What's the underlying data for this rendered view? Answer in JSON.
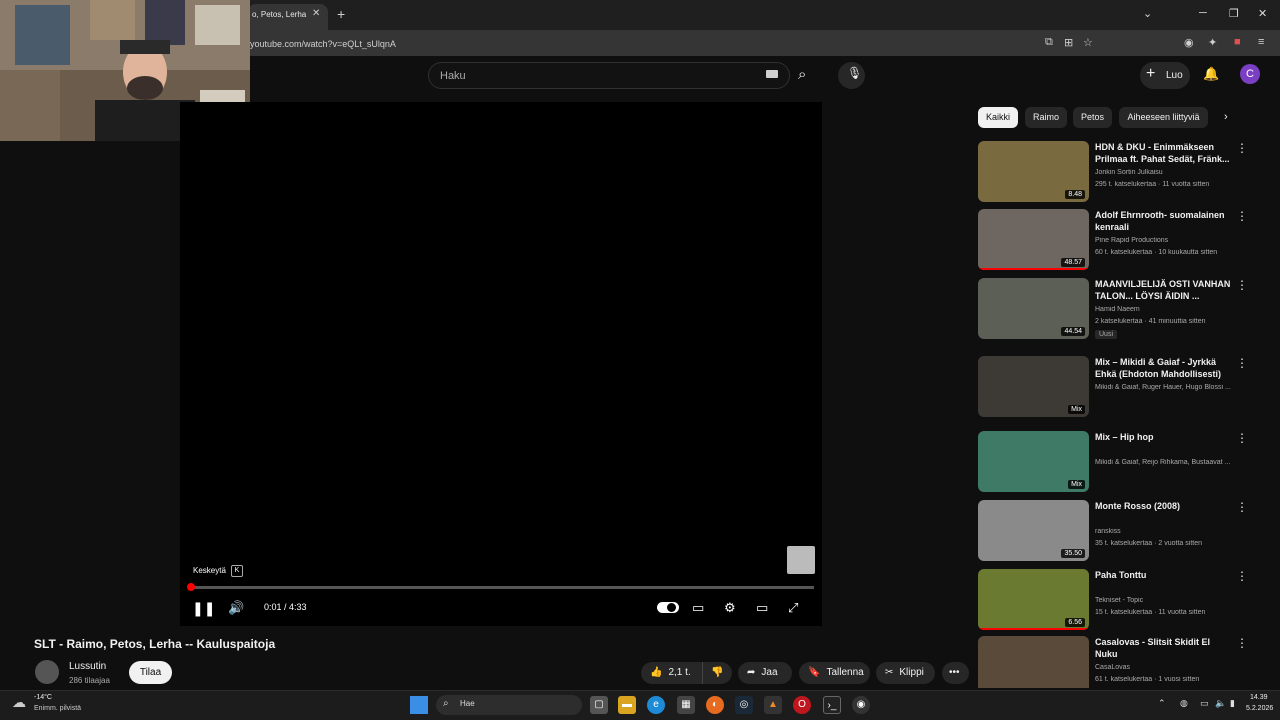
{
  "browser": {
    "tab_title": "o, Petos, Lerha",
    "url": "youtube.com/watch?v=eQLt_sUlqnA"
  },
  "header": {
    "search_placeholder": "Haku",
    "create_label": "Luo",
    "avatar_letter": "C"
  },
  "player": {
    "tooltip": "Keskeytä",
    "tooltip_key": "K",
    "time": "0:01 / 4:33",
    "progress": 0.004
  },
  "video": {
    "title": "SLT - Raimo, Petos, Lerha -- Kauluspaitoja",
    "channel": "Lussutin",
    "subscribers": "286 tilaajaa",
    "subscribe_label": "Tilaa",
    "like_count": "2,1 t.",
    "share_label": "Jaa",
    "save_label": "Tallenna",
    "clip_label": "Klippi"
  },
  "chips": [
    "Kaikki",
    "Raimo",
    "Petos",
    "Aiheeseen liittyviä"
  ],
  "recommendations": [
    {
      "title": "HDN & DKU - Enimmäkseen Prilmaa ft. Pahat Sedät, Fränk...",
      "channel": "Jonkin Sortin Julkaisu",
      "meta": "295 t. katselukertaa · 11 vuotta sitten",
      "duration": "8.48",
      "badge": "",
      "thumb_color": "#7a6a40",
      "progress": 0
    },
    {
      "title": "Adolf Ehrnrooth- suomalainen kenraali",
      "channel": "Pine Rapid Productions",
      "meta": "60 t. katselukertaa · 10 kuukautta sitten",
      "duration": "48.57",
      "badge": "",
      "thumb_color": "#6e6660",
      "progress": 1.0
    },
    {
      "title": "MAANVILJELIJÄ OSTI VANHAN TALON... LÖYSI ÄIDIN ...",
      "channel": "Hamid Naeem",
      "meta": "2 katselukertaa · 41 minuuttia sitten",
      "duration": "44.54",
      "badge": "Uusi",
      "thumb_color": "#5c5f55",
      "progress": 0
    },
    {
      "title": "Mix – Mikidi & Gaiaf - Jyrkkä Ehkä (Ehdoton Mahdollisesti)",
      "channel": "Mikidi & Gaiaf, Ruger Hauer, Hugo Blossi ...",
      "meta": "",
      "duration": "Mix",
      "badge": "",
      "thumb_color": "#3d3a35",
      "progress": 0
    },
    {
      "title": "Mix – Hip hop",
      "channel": "Mikidi & Gaiaf, Reijo Rihkama, Bustaavat ...",
      "meta": "",
      "duration": "Mix",
      "badge": "",
      "thumb_color": "#3f7a66",
      "progress": 0
    },
    {
      "title": "Monte Rosso (2008)",
      "channel": "ranskiss",
      "meta": "35 t. katselukertaa · 2 vuotta sitten",
      "duration": "35.50",
      "badge": "",
      "thumb_color": "#8a8a8a",
      "progress": 0
    },
    {
      "title": "Paha Tonttu",
      "channel": "Tekniset - Topic",
      "meta": "15 t. katselukertaa · 11 vuotta sitten",
      "duration": "6.56",
      "badge": "",
      "thumb_color": "#6a7a30",
      "progress": 1.0
    },
    {
      "title": "Casalovas - Slitsit Skidit El Nuku",
      "channel": "CasaLovas",
      "meta": "61 t. katselukertaa · 1 vuosi sitten",
      "duration": "",
      "badge": "",
      "thumb_color": "#5a4a3a",
      "progress": 0
    }
  ],
  "taskbar": {
    "temp": "-14°C",
    "weather": "Enimm. pilvistä",
    "search_label": "Hae",
    "time": "14.39",
    "date": "5.2.2026"
  }
}
